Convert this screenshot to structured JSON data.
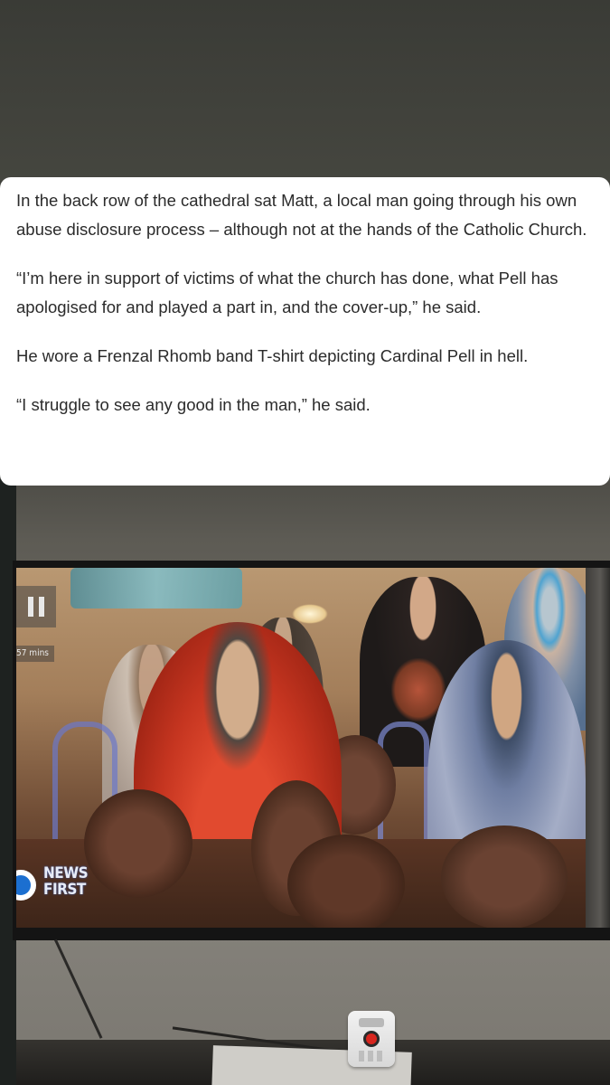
{
  "article": {
    "paragraphs": [
      "In the back row of the cathedral sat Matt, a local man going through his own abuse disclosure process – although not at the hands of the Catholic Church.",
      "“I’m here in support of victims of what the church has done, what Pell has apologised for and played a part in, and the cover-up,” he said.",
      "He wore a Frenzal Rhomb band T-shirt depicting Cardinal Pell in hell.",
      "“I struggle to see any good in the man,” he said."
    ]
  },
  "tv": {
    "pause_icon": "pause-icon",
    "time_label": "57 mins",
    "channel_logo": {
      "line1": "NEWS",
      "line2": "FIRST"
    }
  },
  "colors": {
    "card_background": "#ffffff",
    "text": "#2b2b2b",
    "background": "#3f403b",
    "logo_blue": "#1c6fd0"
  }
}
